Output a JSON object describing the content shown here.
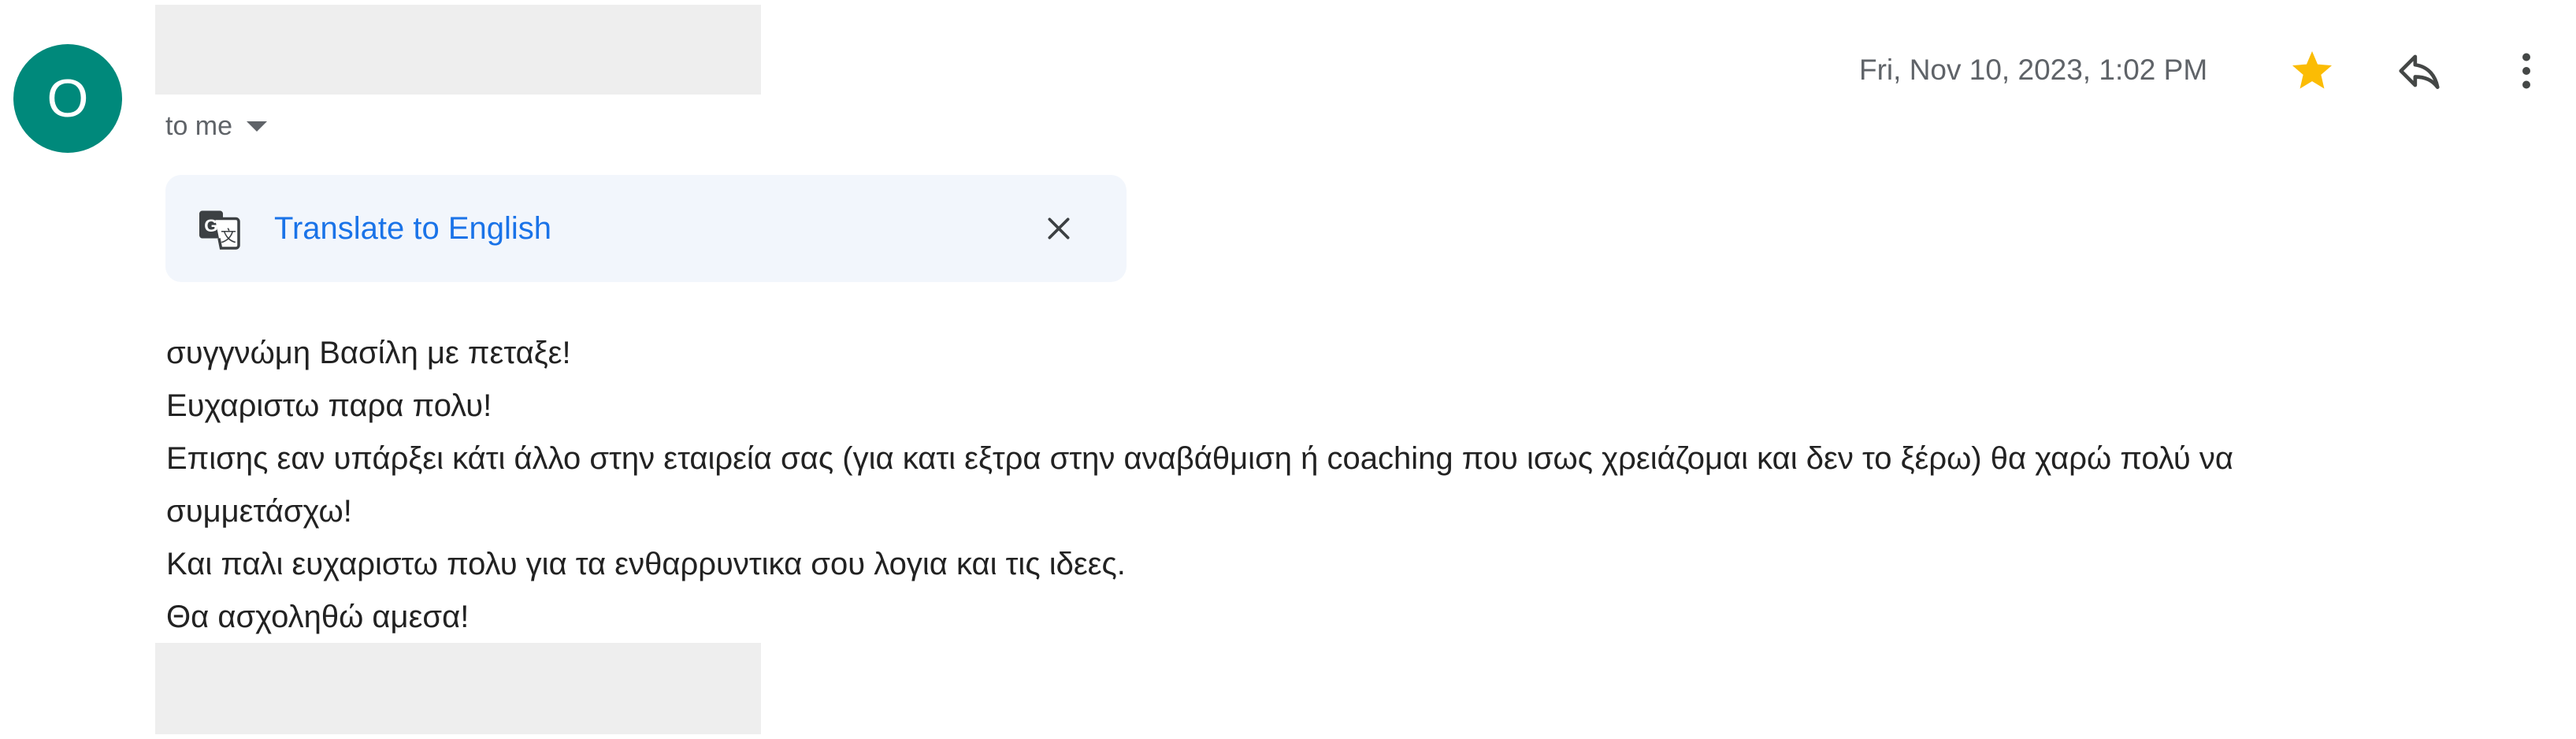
{
  "sender": {
    "avatar_letter": "O",
    "avatar_color": "#00897b"
  },
  "recipient": {
    "label": "to me"
  },
  "message": {
    "date": "Fri, Nov 10, 2023, 1:02 PM",
    "starred": true,
    "body_lines": [
      "συγγνώμη Βασίλη με πεταξε!",
      "Ευχαριστω παρα πολυ!",
      "Επισης εαν υπάρξει κάτι άλλο στην εταιρεία σας (για κατι εξτρα στην αναβάθμιση ή coaching που ισως χρειάζομαι και δεν το ξέρω) θα χαρώ πολύ να",
      "συμμετάσχω!",
      "Και παλι ευχαριστω πολυ για τα ενθαρρυντικα σου λογια και τις ιδεες.",
      "Θα ασχοληθώ αμεσα!"
    ]
  },
  "translate_bar": {
    "link_label": "Translate to English"
  },
  "icons": {
    "star": "star-icon",
    "reply": "reply-icon",
    "more": "more-vert-icon",
    "translate": "translate-icon",
    "close": "close-icon",
    "caret": "caret-down-icon"
  },
  "colors": {
    "accent_link": "#1a73e8",
    "star": "#fbbc04",
    "translate_bg": "#f2f6fc",
    "redaction": "#eeeeee"
  }
}
